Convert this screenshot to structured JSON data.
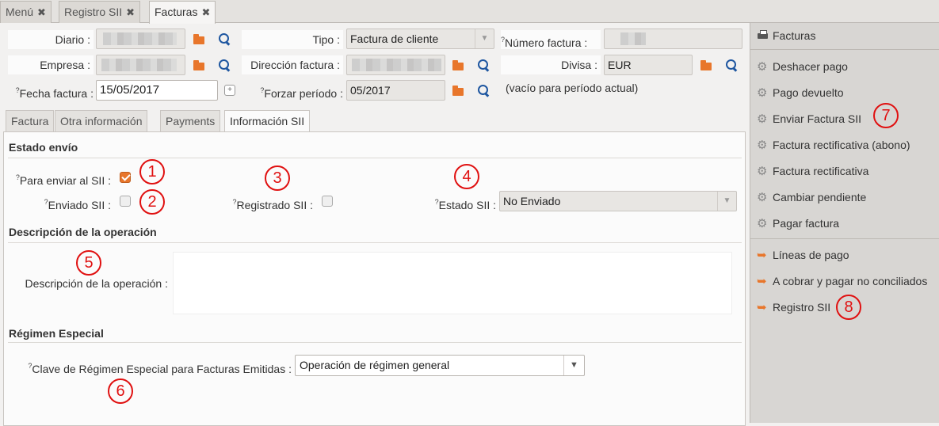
{
  "top_tabs": [
    {
      "label": "Menú"
    },
    {
      "label": "Registro SII"
    },
    {
      "label": "Facturas"
    }
  ],
  "header": {
    "diario_label": "Diario :",
    "tipo_label": "Tipo :",
    "tipo_value": "Factura de cliente",
    "numero_label": "Número factura :",
    "empresa_label": "Empresa :",
    "direccion_label": "Dirección factura :",
    "divisa_label": "Divisa :",
    "divisa_value": "EUR",
    "fecha_label": "Fecha factura :",
    "fecha_value": "15/05/2017",
    "forzar_label": "Forzar período :",
    "forzar_value": "05/2017",
    "forzar_hint": "(vacío para período actual)",
    "help_mark": "?"
  },
  "inner_tabs": [
    {
      "label": "Factura"
    },
    {
      "label": "Otra información"
    },
    {
      "label": "Payments"
    },
    {
      "label": "Información SII"
    }
  ],
  "sii": {
    "estado_envio_title": "Estado envío",
    "para_enviar_label": "Para enviar al SII :",
    "para_enviar_checked": true,
    "enviado_label": "Enviado SII :",
    "enviado_checked": false,
    "registrado_label": "Registrado SII :",
    "registrado_checked": false,
    "estado_label": "Estado SII :",
    "estado_value": "No Enviado",
    "descripcion_title": "Descripción de la operación",
    "descripcion_label": "Descripción de la operación :",
    "descripcion_value": "",
    "regimen_title": "Régimen Especial",
    "clave_label": "Clave de Régimen Especial para Facturas Emitidas :",
    "clave_value": "Operación de régimen general"
  },
  "annotations": [
    "1",
    "2",
    "3",
    "4",
    "5",
    "6",
    "7",
    "8"
  ],
  "sidebar": {
    "print_title": "Facturas",
    "actions": [
      {
        "label": "Deshacer pago",
        "icon": "gear-icon"
      },
      {
        "label": "Pago devuelto",
        "icon": "gear-icon"
      },
      {
        "label": "Enviar Factura SII",
        "icon": "gear-icon"
      },
      {
        "label": "Factura rectificativa (abono)",
        "icon": "gear-icon"
      },
      {
        "label": "Factura rectificativa",
        "icon": "gear-icon"
      },
      {
        "label": "Cambiar pendiente",
        "icon": "gear-icon"
      },
      {
        "label": "Pagar factura",
        "icon": "gear-icon"
      }
    ],
    "relates": [
      {
        "label": "Líneas de pago",
        "icon": "arrow-icon"
      },
      {
        "label": "A cobrar y pagar no conciliados",
        "icon": "arrow-icon"
      },
      {
        "label": "Registro SII",
        "icon": "arrow-icon"
      }
    ]
  },
  "colors": {
    "accent": "#e8762b",
    "annotation": "#e01010",
    "search_icon": "#1e56a0"
  }
}
